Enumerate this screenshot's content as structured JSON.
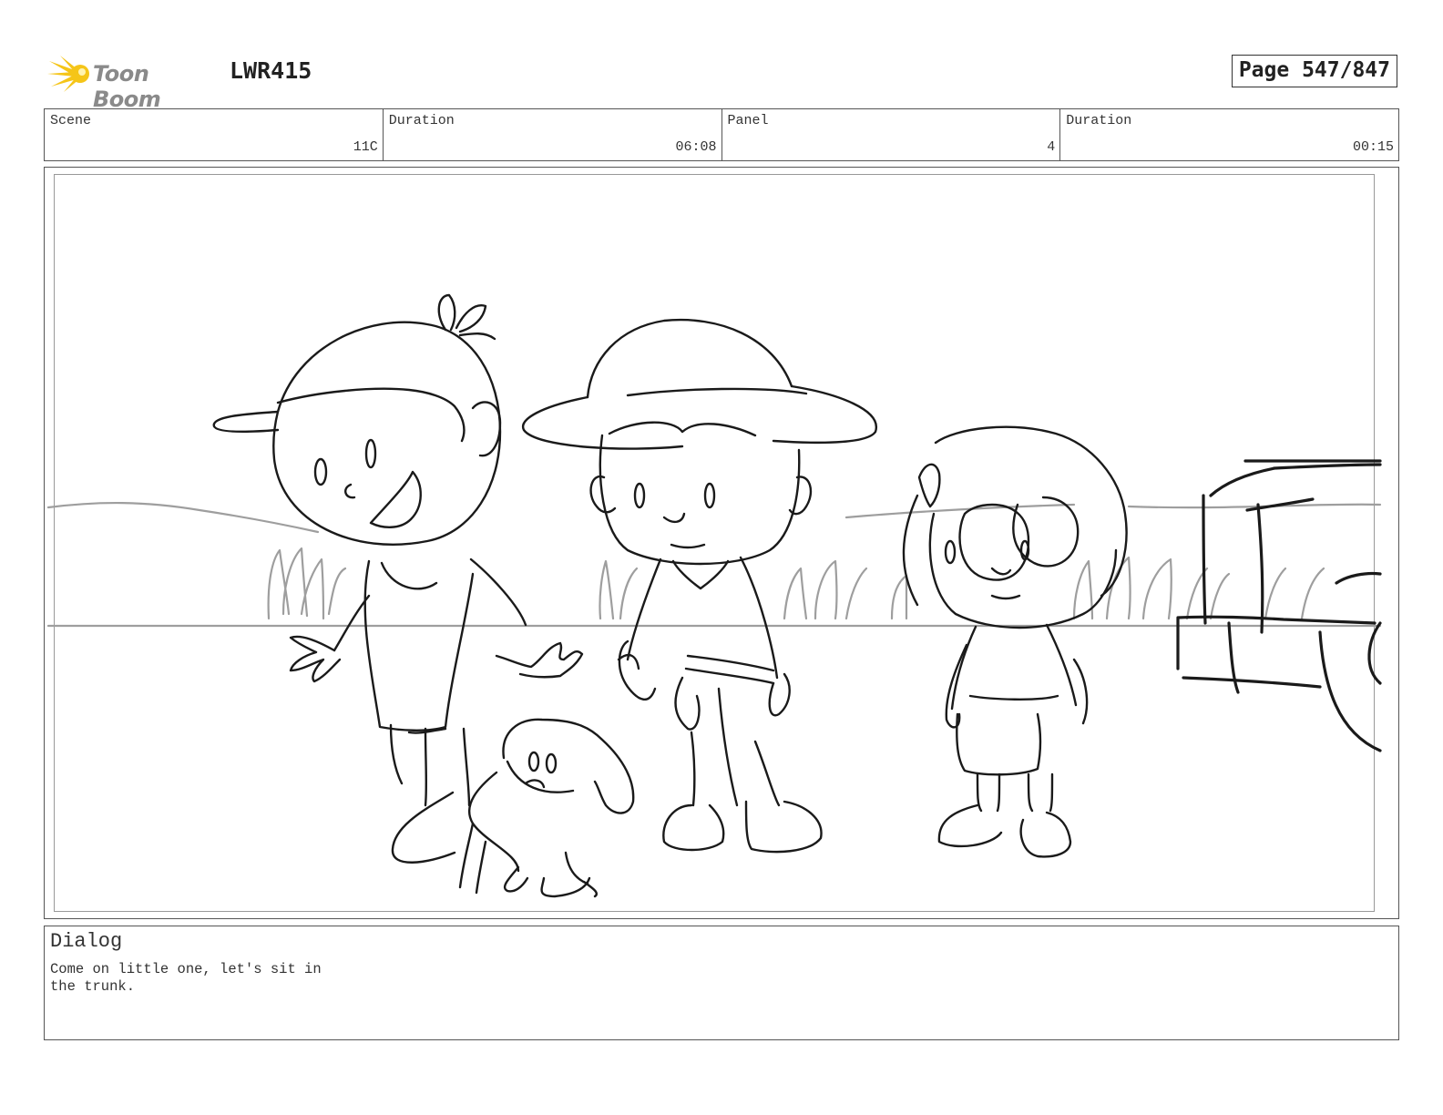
{
  "header": {
    "logo_text": "Toon Boom",
    "project_code": "LWR415",
    "page_label": "Page 547/847"
  },
  "info": [
    {
      "label": "Scene",
      "value": "11C"
    },
    {
      "label": "Duration",
      "value": "06:08"
    },
    {
      "label": "Panel",
      "value": "4"
    },
    {
      "label": "Duration",
      "value": "00:15"
    }
  ],
  "dialog": {
    "title": "Dialog",
    "text": "Come on little one, let's sit in\nthe trunk."
  },
  "colors": {
    "logo_yellow": "#f5c518",
    "sketch_line": "#1a1a1a",
    "background_line": "#9e9e9e"
  }
}
